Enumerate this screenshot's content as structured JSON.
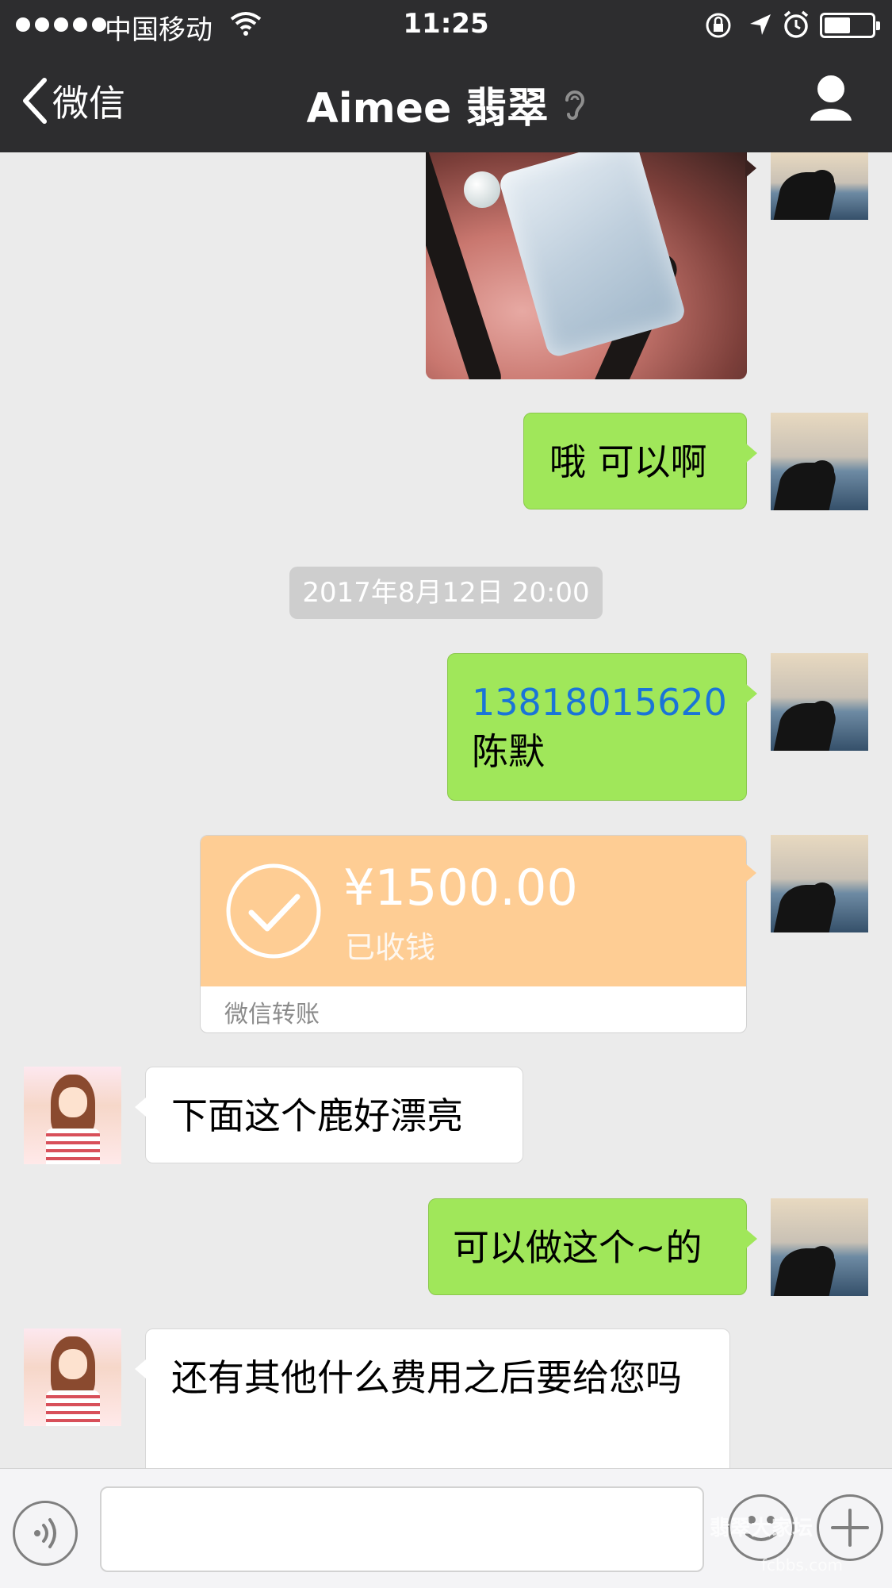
{
  "status_bar": {
    "carrier": "中国移动",
    "time": "11:25"
  },
  "nav": {
    "back_label": "微信",
    "title": "Aimee 翡翠"
  },
  "messages": {
    "m1_text": "哦 可以啊",
    "timestamp": "2017年8月12日 20:00",
    "m2_phone": "13818015620",
    "m2_name": "陈默",
    "transfer_amount": "¥1500.00",
    "transfer_status": "已收钱",
    "transfer_footer": "微信转账",
    "m3_text": "下面这个鹿好漂亮",
    "m4_text": "可以做这个~的",
    "m5_text": "还有其他什么费用之后要给您吗"
  },
  "watermark": {
    "text": "翡翠大家坛",
    "subtext": "fcbbs.com"
  },
  "colors": {
    "bar": "#2d2d2f",
    "chat_bg": "#ebebeb",
    "sent_bubble": "#a0e75a",
    "transfer": "#fecd94",
    "link": "#1a74d8"
  }
}
